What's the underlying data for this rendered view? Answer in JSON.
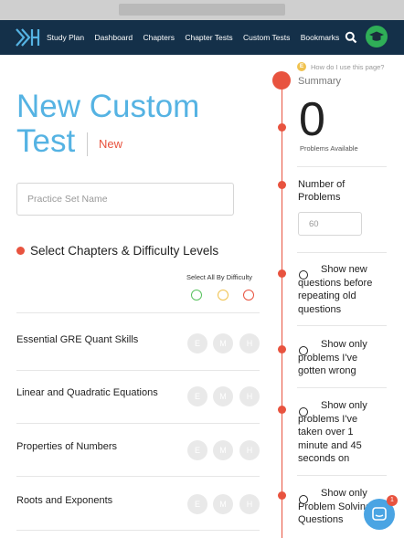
{
  "nav": {
    "links": [
      "Study Plan",
      "Dashboard",
      "Chapters",
      "Chapter Tests",
      "Custom Tests",
      "Bookmarks"
    ]
  },
  "header": {
    "title": "New Custom Test",
    "tag": "New"
  },
  "practice_set": {
    "placeholder": "Practice Set Name"
  },
  "chapters_section": {
    "title": "Select Chapters & Difficulty Levels",
    "select_all_label": "Select All By Difficulty",
    "difficulty_colors": {
      "easy": "#58c25e",
      "medium": "#f0c24f",
      "hard": "#e8533f"
    },
    "difficulty_letters": [
      "E",
      "M",
      "H"
    ],
    "chapters": [
      {
        "name": "Essential GRE Quant Skills"
      },
      {
        "name": "Linear and Quadratic Equations"
      },
      {
        "name": "Properties of Numbers"
      },
      {
        "name": "Roots and Exponents"
      }
    ]
  },
  "summary": {
    "help_icon_letter": "E",
    "help_text": "How do I use this page?",
    "title": "Summary",
    "problems_available": "0",
    "problems_available_label": "Problems Available",
    "num_problems_label": "Number of Problems",
    "num_problems_placeholder": "60",
    "options": [
      {
        "label": "Show new questions before repeating old questions"
      },
      {
        "label": "Show only problems I've gotten wrong"
      },
      {
        "label": "Show only problems I've taken over 1 minute and 45 seconds on"
      },
      {
        "label": "Show only Problem Solving Questions"
      }
    ]
  },
  "chat": {
    "badge_count": "1"
  },
  "colors": {
    "navy": "#143049",
    "accent_blue": "#55b3e3",
    "accent_red": "#e8533f",
    "avatar_green": "#2fae57"
  }
}
